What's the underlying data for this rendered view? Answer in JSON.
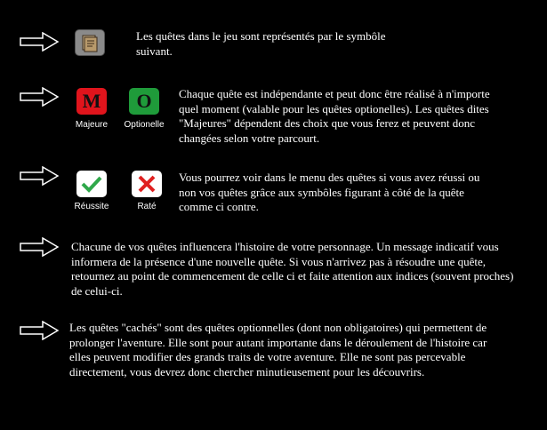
{
  "sections": [
    {
      "text": "Les quêtes dans le jeu sont représentés par le symbôle suivant."
    },
    {
      "text": "Chaque quête est indépendante et peut donc être réalisé à n'importe quel moment (valable pour les quêtes optionelles). Les quêtes dites \"Majeures\" dépendent des choix que vous ferez et peuvent donc changées selon votre parcourt."
    },
    {
      "text": "Vous pourrez voir dans le menu des quêtes si vous avez réussi ou non vos quêtes grâce aux symbôles figurant à côté de la quête comme ci contre."
    },
    {
      "text": "Chacune de vos quêtes influencera l'histoire de votre personnage. Un message indicatif vous informera de la présence d'une nouvelle quête. Si vous n'arrivez pas à résoudre une quête, retournez au point de commencement de celle ci et faite attention aux indices (souvent proches) de celui-ci."
    },
    {
      "text": "Les quêtes \"cachés\" sont des quêtes optionnelles (dont non obligatoires) qui permettent de prolonger l'aventure. Elle sont pour autant importante dans le déroulement de l'histoire car elles peuvent modifier des grands traits de votre aventure. Elle ne sont pas percevable directement, vous devrez donc chercher minutieusement pour les découvrirs."
    }
  ],
  "icons": {
    "major": {
      "letter": "M",
      "label": "Majeure",
      "color": "#e0141c"
    },
    "optional": {
      "letter": "O",
      "label": "Optionelle",
      "color": "#1f9b3a"
    },
    "success": {
      "label": "Réussite",
      "color": "#2fa84a"
    },
    "failed": {
      "label": "Raté",
      "color": "#e02020"
    }
  }
}
